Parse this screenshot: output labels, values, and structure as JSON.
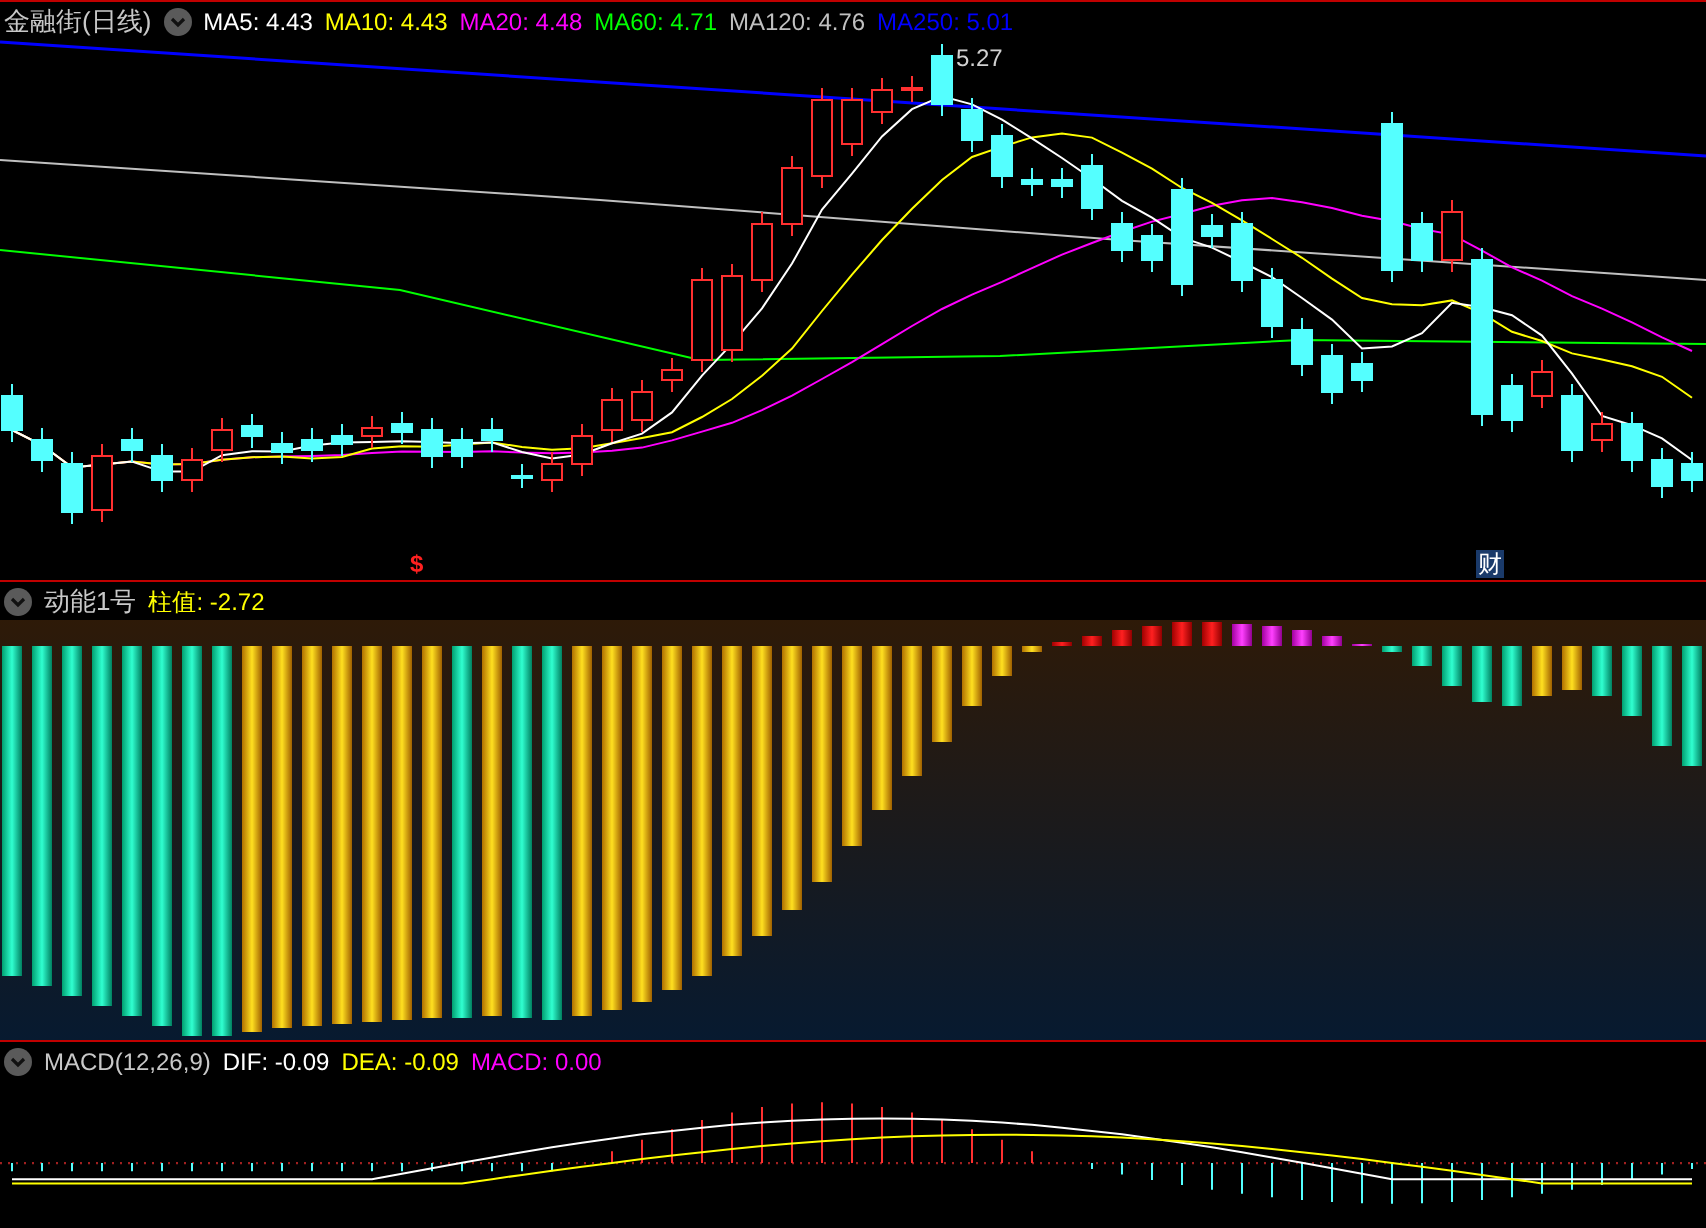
{
  "main_panel": {
    "title": "金融街(日线)",
    "indicators": [
      {
        "label": "MA5: 4.43",
        "color": "#ffffff"
      },
      {
        "label": "MA10: 4.43",
        "color": "#ffff00"
      },
      {
        "label": "MA20: 4.48",
        "color": "#ff00ff"
      },
      {
        "label": "MA60: 4.71",
        "color": "#00ff00"
      },
      {
        "label": "MA120: 4.76",
        "color": "#c0c0c0"
      },
      {
        "label": "MA250: 5.01",
        "color": "#0000ff"
      }
    ],
    "peak_label": "5.27",
    "markers": [
      {
        "kind": "signal",
        "text": "$"
      },
      {
        "kind": "finance",
        "text": "财"
      }
    ]
  },
  "momentum_panel": {
    "title": "动能1号",
    "value_label": "柱值: -2.72"
  },
  "macd_panel": {
    "title": "MACD(12,26,9)",
    "indicators": [
      {
        "label": "DIF: -0.09",
        "color": "#ffffff"
      },
      {
        "label": "DEA: -0.09",
        "color": "#ffff00"
      },
      {
        "label": "MACD: 0.00",
        "color": "#ff00ff"
      }
    ]
  }
}
